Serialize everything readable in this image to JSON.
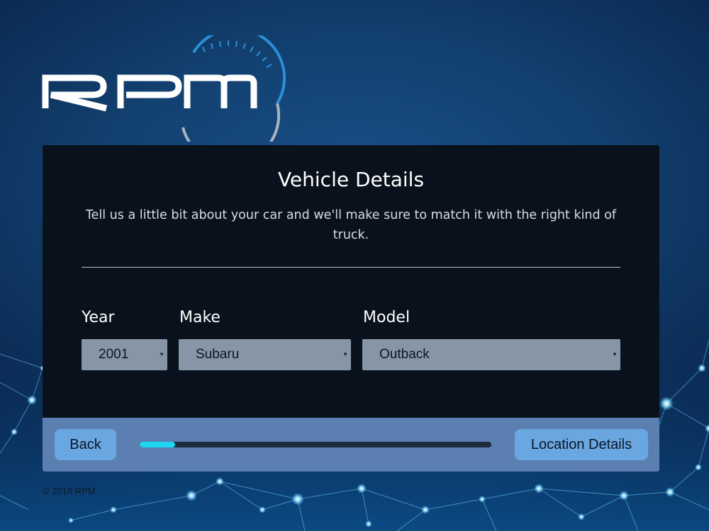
{
  "brand": {
    "logo_text": "RPM",
    "accent_color": "#2a8fd6"
  },
  "card": {
    "title": "Vehicle Details",
    "subtitle": "Tell us a little bit about your car and we'll make sure to match it with the right kind of truck."
  },
  "form": {
    "year": {
      "label": "Year",
      "value": "2001"
    },
    "make": {
      "label": "Make",
      "value": "Subaru"
    },
    "model": {
      "label": "Model",
      "value": "Outback"
    }
  },
  "footer": {
    "back_label": "Back",
    "next_label": "Location Details",
    "progress_fraction": 0.1
  },
  "copyright": "© 2018 RPM"
}
